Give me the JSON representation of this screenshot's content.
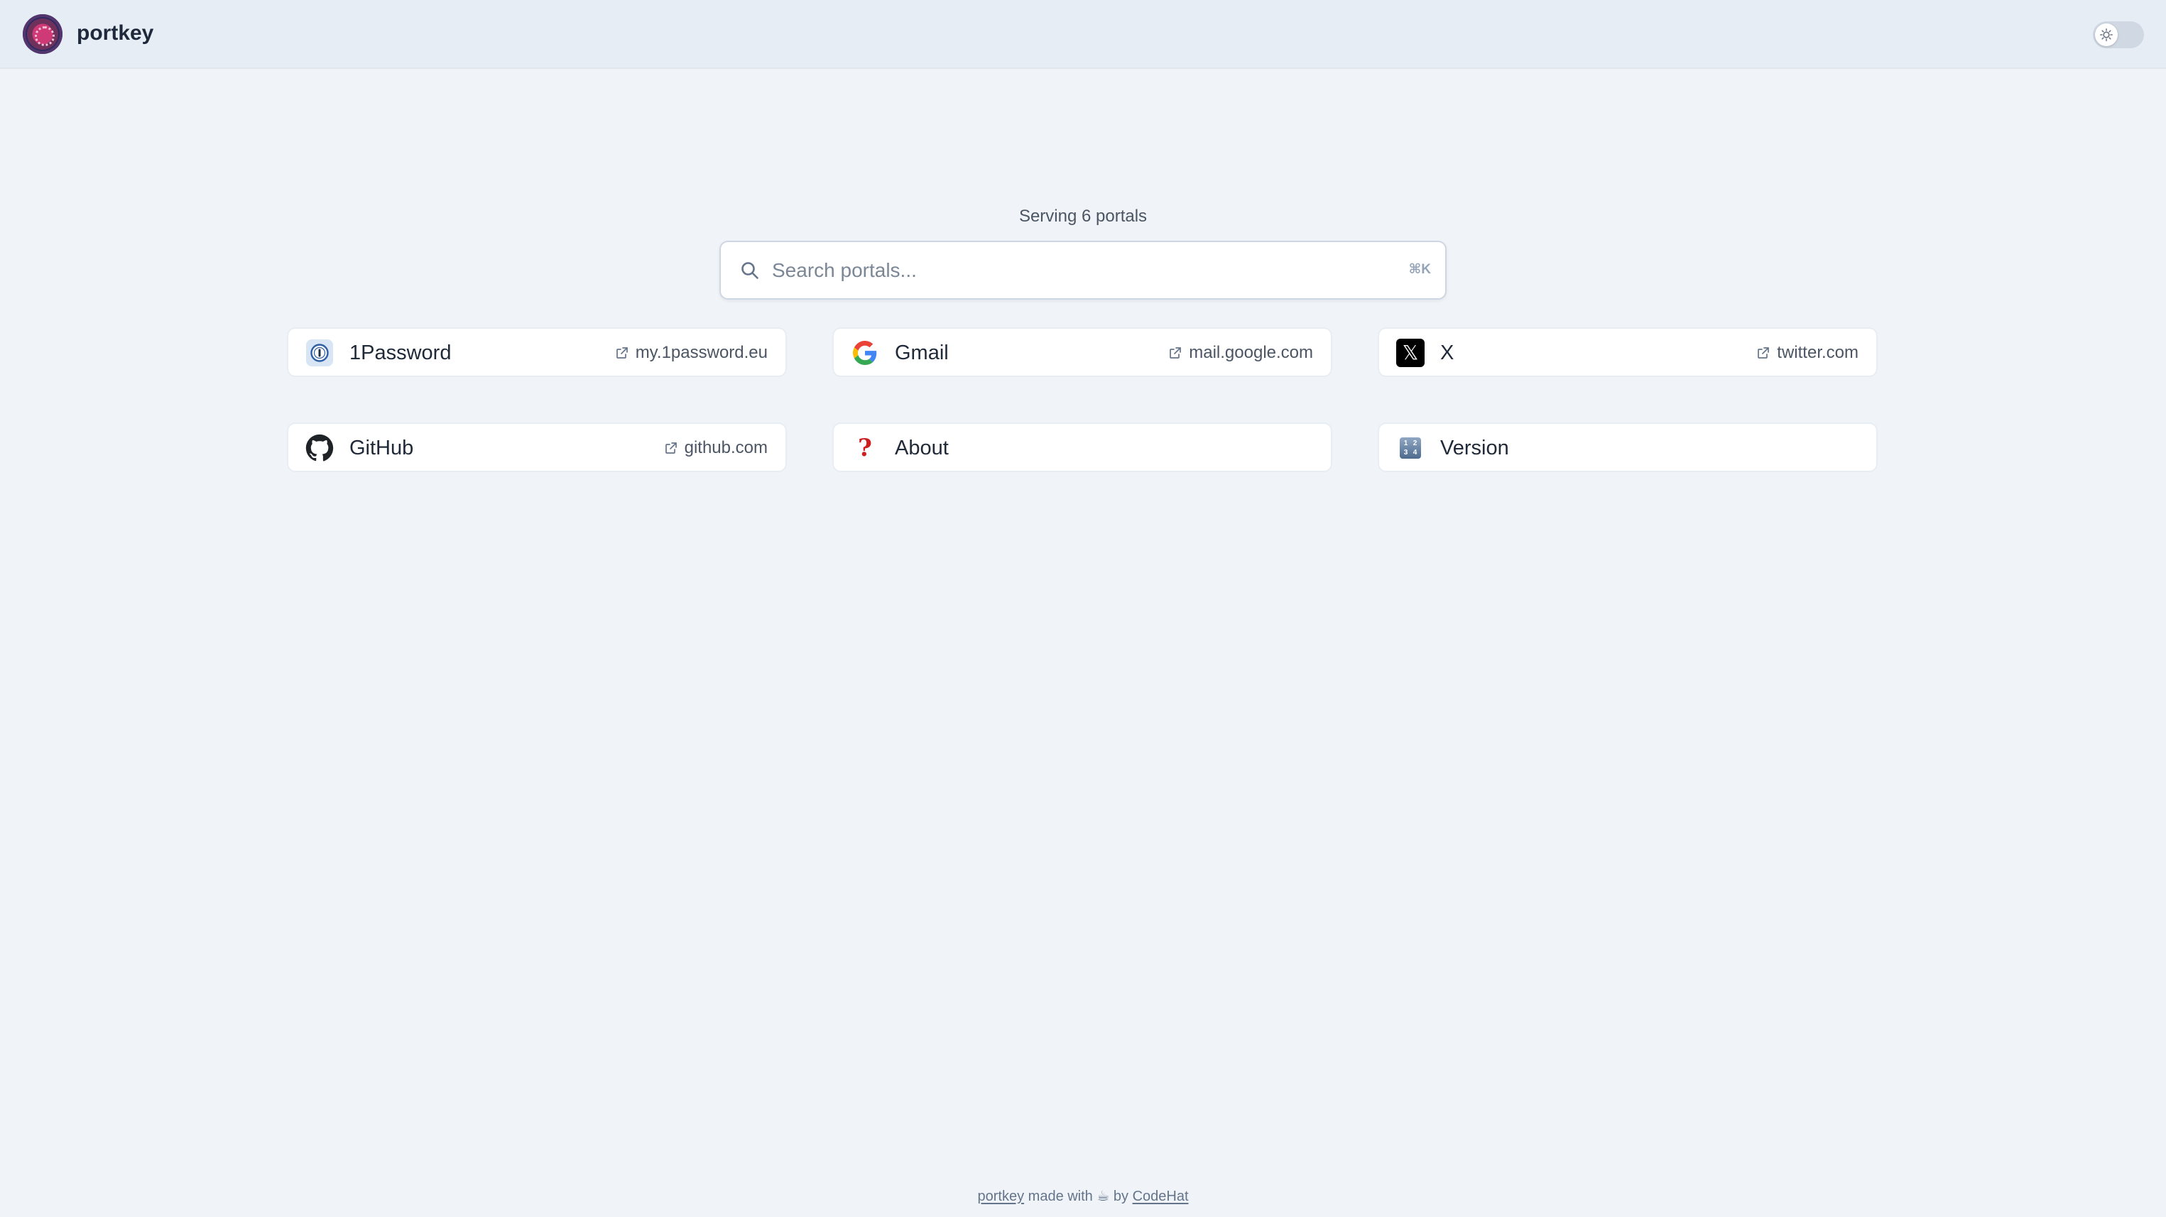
{
  "header": {
    "brand": "portkey",
    "theme_toggle_icon": "sun-icon"
  },
  "status": {
    "serving_text": "Serving 6 portals"
  },
  "search": {
    "placeholder": "Search portals...",
    "value": "",
    "shortcut": "⌘K"
  },
  "portals": [
    {
      "title": "1Password",
      "link": "my.1password.eu",
      "icon": "1password-icon"
    },
    {
      "title": "Gmail",
      "link": "mail.google.com",
      "icon": "google-icon"
    },
    {
      "title": "X",
      "link": "twitter.com",
      "icon": "x-logo-icon"
    },
    {
      "title": "GitHub",
      "link": "github.com",
      "icon": "github-icon"
    },
    {
      "title": "About",
      "link": "",
      "icon": "question-mark-icon"
    },
    {
      "title": "Version",
      "link": "",
      "icon": "numbers-icon"
    }
  ],
  "footer": {
    "brand_link": "portkey",
    "made_with": "made with",
    "coffee": "☕",
    "by": "by",
    "author_link": "CodeHat"
  },
  "colors": {
    "background": "#f0f4f8",
    "header": "#e7edf4",
    "card": "#ffffff",
    "text": "#1f2937",
    "muted": "#64748b",
    "about_icon": "#cc1f1f"
  },
  "version_icon_digits": [
    "1",
    "2",
    "3",
    "4"
  ]
}
